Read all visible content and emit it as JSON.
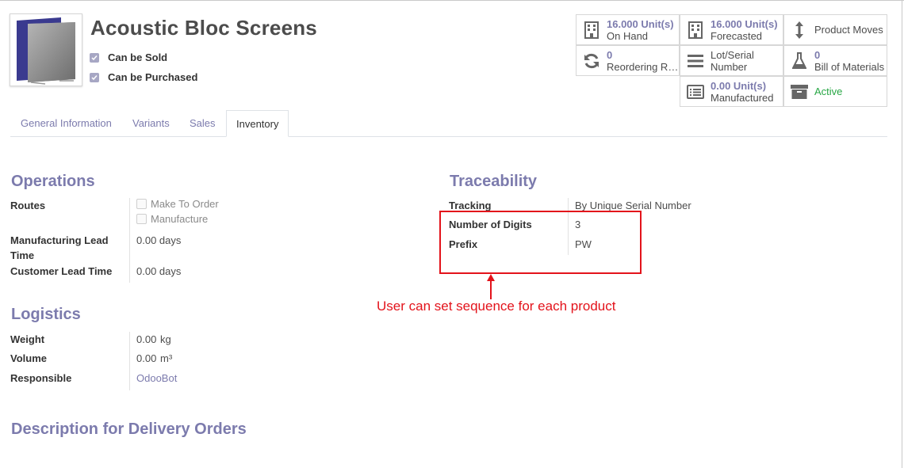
{
  "product": {
    "name": "Acoustic Bloc Screens",
    "can_be_sold": "Can be Sold",
    "can_be_purchased": "Can be Purchased"
  },
  "stats": [
    {
      "value": "16.000 Unit(s)",
      "label": "On Hand",
      "icon": "building-icon"
    },
    {
      "value": "16.000 Unit(s)",
      "label": "Forecasted",
      "icon": "building-icon"
    },
    {
      "value": "",
      "label": "Product Moves",
      "icon": "up-down-arrow-icon"
    },
    {
      "value": "0",
      "label": "Reordering R…",
      "icon": "refresh-icon"
    },
    {
      "value": "",
      "label": "Lot/Serial",
      "label2": "Number",
      "icon": "list-icon"
    },
    {
      "value": "0",
      "label": "Bill of Materials",
      "icon": "flask-icon"
    },
    {
      "value": "0.00 Unit(s)",
      "label": "Manufactured",
      "icon": "list-alt-icon"
    },
    {
      "value": "",
      "label": "Active",
      "icon": "archive-icon"
    }
  ],
  "tabs": [
    "General Information",
    "Variants",
    "Sales",
    "Inventory"
  ],
  "operations": {
    "title": "Operations",
    "routes_label": "Routes",
    "routes": [
      "Make To Order",
      "Manufacture"
    ],
    "mfg_lead_label_1": "Manufacturing Lead",
    "mfg_lead_label_2": "Time",
    "mfg_lead_value": "0.00 days",
    "customer_lead_label": "Customer Lead Time",
    "customer_lead_value": "0.00 days"
  },
  "logistics": {
    "title": "Logistics",
    "weight_label": "Weight",
    "weight_value": "0.00",
    "weight_unit": "kg",
    "volume_label": "Volume",
    "volume_value": "0.00",
    "volume_unit": "m³",
    "responsible_label": "Responsible",
    "responsible_value": "OdooBot"
  },
  "traceability": {
    "title": "Traceability",
    "tracking_label": "Tracking",
    "tracking_value": "By Unique Serial Number",
    "digits_label": "Number of Digits",
    "digits_value": "3",
    "prefix_label": "Prefix",
    "prefix_value": "PW"
  },
  "description": {
    "title": "Description for Delivery Orders"
  },
  "annotation": {
    "text": "User can set sequence for each product"
  },
  "colors": {
    "accent": "#7c7bad",
    "annotation": "#e3131b",
    "active": "#28a745"
  }
}
